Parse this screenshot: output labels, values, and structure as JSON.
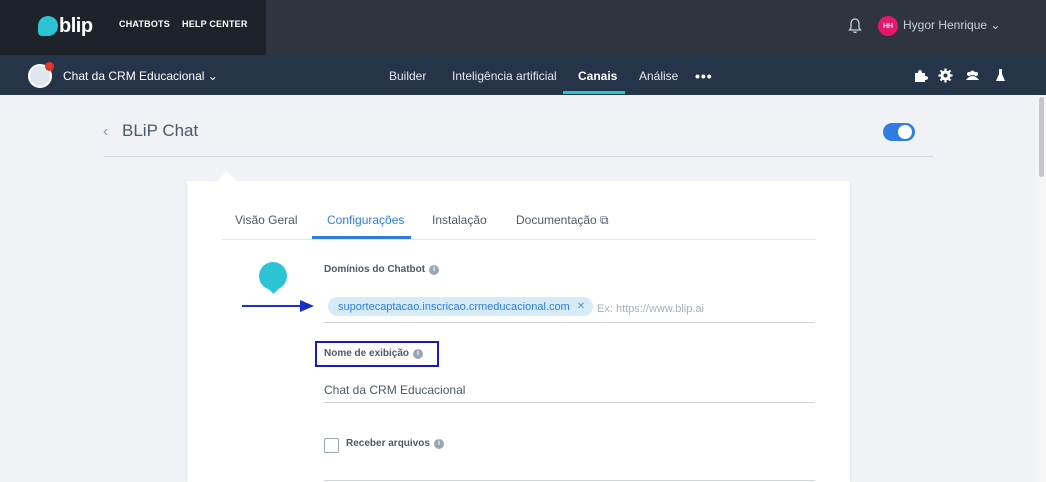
{
  "topbar": {
    "logo_text": "blip",
    "nav": [
      {
        "label": "CHATBOTS"
      },
      {
        "label": "HELP CENTER"
      }
    ],
    "user": {
      "initials": "HH",
      "name": "Hygor Henrique ⌄"
    }
  },
  "subbar": {
    "bot_name": "Chat da CRM Educacional ⌄",
    "nav": [
      {
        "label": "Builder"
      },
      {
        "label": "Inteligência artificial"
      },
      {
        "label": "Canais",
        "active": true
      },
      {
        "label": "Análise"
      }
    ],
    "more": "•••",
    "tools": [
      "puzzle-icon",
      "gear-icon",
      "users-icon",
      "flask-icon"
    ]
  },
  "page": {
    "title": "BLiP Chat",
    "enabled": true
  },
  "tabs": [
    {
      "label": "Visão Geral"
    },
    {
      "label": "Configurações",
      "active": true
    },
    {
      "label": "Instalação"
    },
    {
      "label": "Documentação ⧉"
    }
  ],
  "form": {
    "domains_label": "Domínios do Chatbot",
    "domain_chip": "suportecaptacao.inscricao.crmeducacional.com",
    "domain_placeholder": "Ex: https://www.blip.ai",
    "display_name_label": "Nome de exibição",
    "display_name_value": "Chat da CRM Educacional",
    "receive_files_label": "Receber arquivos"
  },
  "colors": {
    "accent": "#2f7de1",
    "brand": "#2cc3d5",
    "annotation": "#1a1ab8"
  }
}
